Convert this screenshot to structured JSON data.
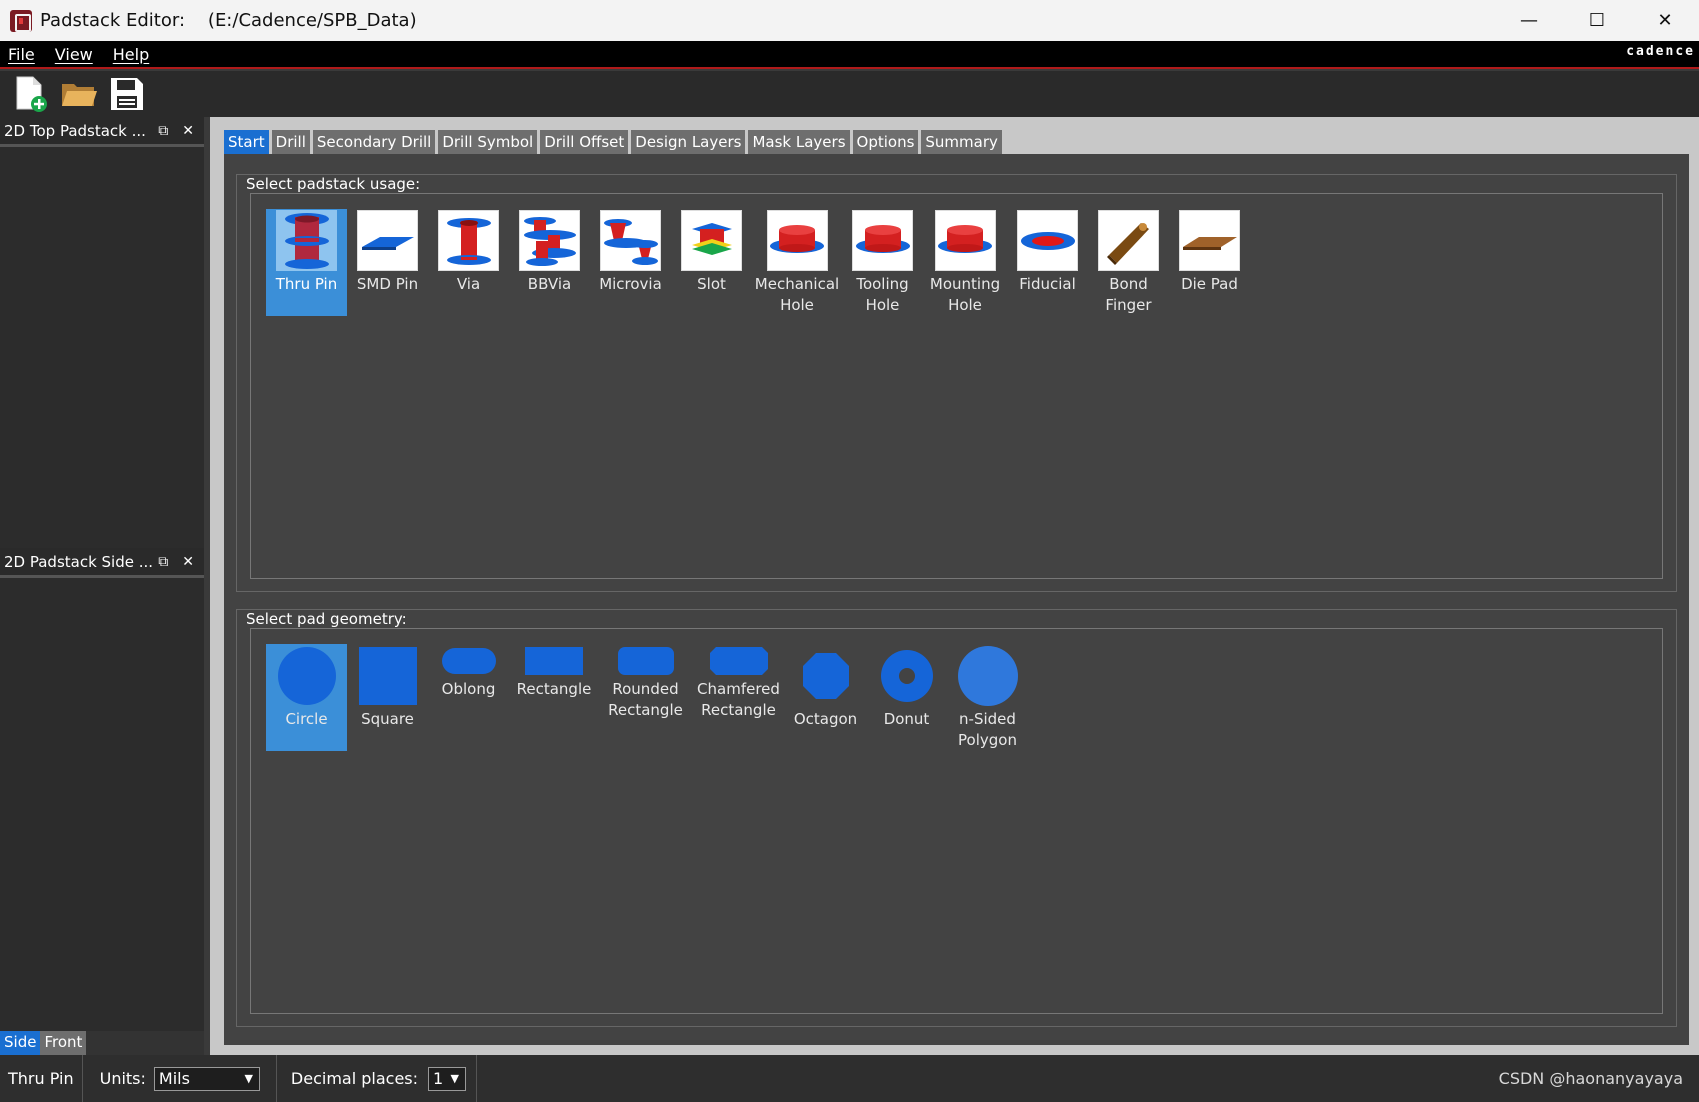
{
  "window": {
    "title": "Padstack Editor:    (E:/Cadence/SPB_Data)",
    "minimize": "—",
    "maximize": "☐",
    "close": "✕"
  },
  "menu": {
    "file": "File",
    "view": "View",
    "help": "Help"
  },
  "brand": "cadence",
  "toolbar": {
    "new_icon": "new-file-icon",
    "open_icon": "folder-open-icon",
    "save_icon": "save-icon"
  },
  "panels": {
    "top": {
      "title": "2D Top Padstack ...",
      "float": "⧉",
      "close": "✕"
    },
    "side": {
      "title": "2D Padstack Side ...",
      "float": "⧉",
      "close": "✕"
    },
    "view_tabs": [
      "Side",
      "Front"
    ]
  },
  "tabs": [
    "Start",
    "Drill",
    "Secondary Drill",
    "Drill Symbol",
    "Drill Offset",
    "Design Layers",
    "Mask Layers",
    "Options",
    "Summary"
  ],
  "usage": {
    "label": "Select padstack usage:",
    "items": [
      "Thru Pin",
      "SMD Pin",
      "Via",
      "BBVia",
      "Microvia",
      "Slot",
      "Mechanical\nHole",
      "Tooling\nHole",
      "Mounting\nHole",
      "Fiducial",
      "Bond\nFinger",
      "Die Pad"
    ],
    "selected": "Thru Pin"
  },
  "geometry": {
    "label": "Select pad geometry:",
    "items": [
      "Circle",
      "Square",
      "Oblong",
      "Rectangle",
      "Rounded\nRectangle",
      "Chamfered\nRectangle",
      "Octagon",
      "Donut",
      "n-Sided\nPolygon"
    ],
    "selected": "Circle"
  },
  "status": {
    "usage": "Thru Pin",
    "units_label": "Units:",
    "units_value": "Mils",
    "decimal_label": "Decimal places:",
    "decimal_value": "1",
    "watermark": "CSDN @haonanyayaya"
  },
  "colors": {
    "accent": "#1a6fd1",
    "selected_bg": "#3b8fd8",
    "pad_blue": "#1565d8",
    "drill_red": "#d42020"
  }
}
